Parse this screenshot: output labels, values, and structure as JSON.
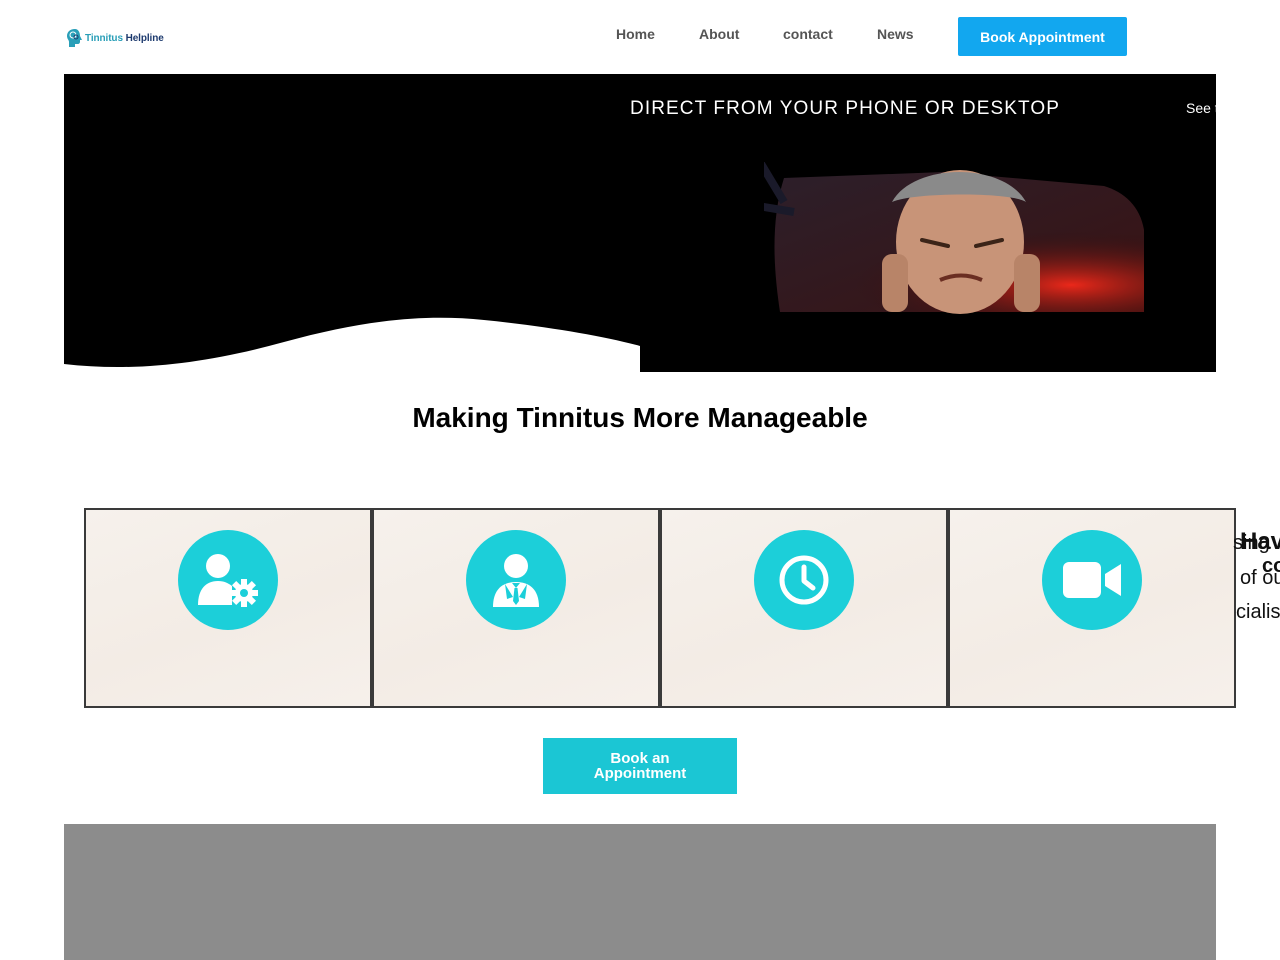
{
  "header": {
    "logo": {
      "word1": "Tinnitus",
      "word2": "Helpline"
    },
    "nav": [
      {
        "label": "Home"
      },
      {
        "label": "About"
      },
      {
        "label": "contact"
      },
      {
        "label": "News"
      }
    ],
    "book_button": "Book Appointment"
  },
  "hero": {
    "title": "DIRECT FROM YOUR PHONE OR DESKTOP",
    "side_text": "See treat"
  },
  "section": {
    "title": "Making Tinnitus More Manageable",
    "cards": [
      {
        "icon": "user-gear-icon"
      },
      {
        "icon": "businessman-icon"
      },
      {
        "icon": "clock-icon"
      },
      {
        "icon": "video-camera-icon"
      }
    ],
    "peek_c": "C",
    "overflow_lines": {
      "line1a": "sing",
      "line1b": "Hav",
      "line2a": "co",
      "line2b": "of ou",
      "line3": "cialis"
    },
    "book_button": "Book an Appointment"
  },
  "colors": {
    "accent_blue": "#12a7ef",
    "accent_teal": "#1ccfd9",
    "button_teal": "#1bc6d4",
    "gray_block": "#8c8c8c"
  }
}
